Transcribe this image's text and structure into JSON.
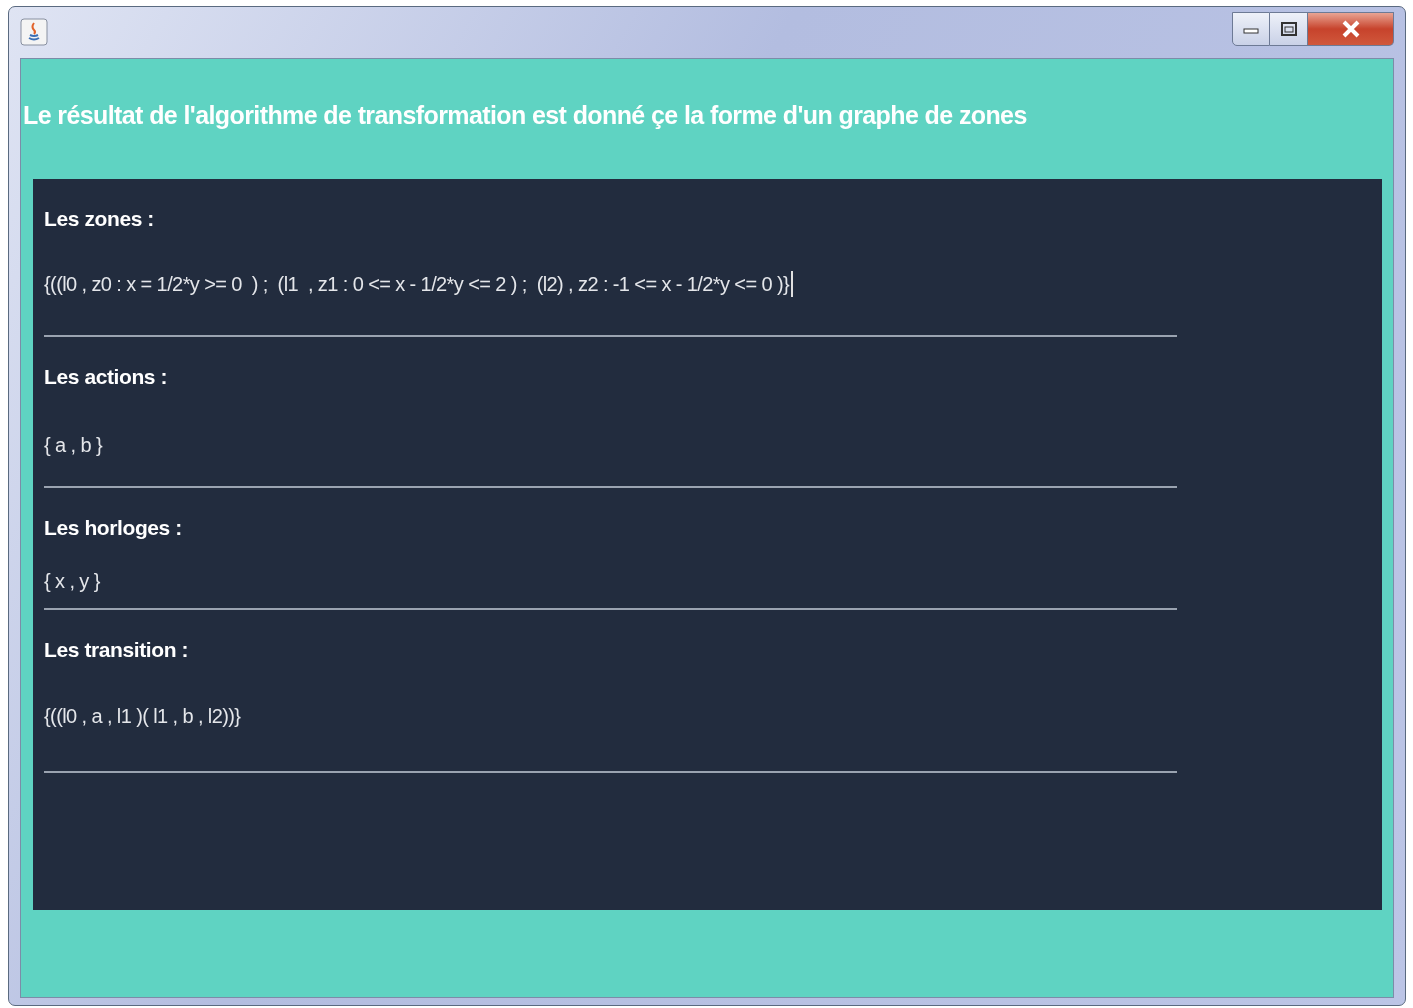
{
  "heading": "Le résultat de l'algorithme de transformation est donné çe la forme d'un graphe de zones",
  "sections": [
    {
      "label": "Les zones :",
      "value": "{((l0 , z0 : x = 1/2*y >= 0  ) ;  (l1  , z1 : 0 <= x - 1/2*y <= 2 ) ;  (l2) , z2 : -1 <= x - 1/2*y <= 0 )}"
    },
    {
      "label": "Les actions :",
      "value": "{ a , b }"
    },
    {
      "label": "Les horloges :",
      "value": "{ x , y }"
    },
    {
      "label": "Les transition :",
      "value": "{((l0 , a , l1 )( l1 , b , l2))}"
    }
  ]
}
